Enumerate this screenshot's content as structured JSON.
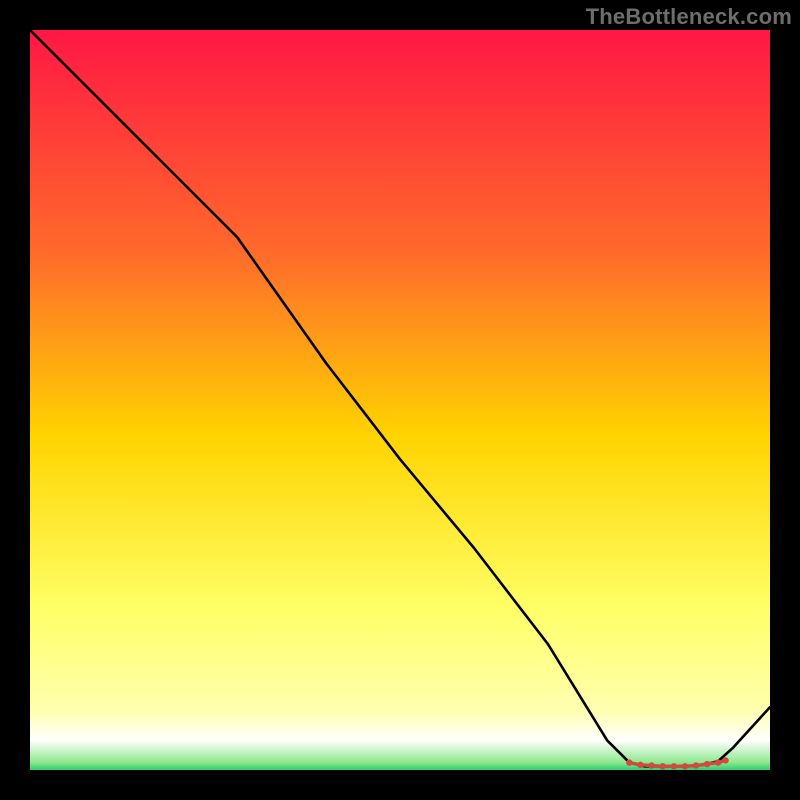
{
  "watermark": "TheBottleneck.com",
  "chart_data": {
    "type": "line",
    "title": "",
    "xlabel": "",
    "ylabel": "",
    "xlim": [
      0,
      100
    ],
    "ylim": [
      0,
      100
    ],
    "grid": false,
    "legend": false,
    "gradient_stops": [
      {
        "offset": 0.0,
        "color": "#ff1744"
      },
      {
        "offset": 0.3,
        "color": "#ff6a2b"
      },
      {
        "offset": 0.55,
        "color": "#ffd400"
      },
      {
        "offset": 0.78,
        "color": "#ffff66"
      },
      {
        "offset": 0.92,
        "color": "#ffffb0"
      },
      {
        "offset": 0.96,
        "color": "#ffffff"
      },
      {
        "offset": 0.99,
        "color": "#8ce88c"
      },
      {
        "offset": 1.0,
        "color": "#2ecc71"
      }
    ],
    "series": [
      {
        "name": "bottleneck-curve",
        "x": [
          0,
          8,
          20,
          28,
          40,
          50,
          60,
          70,
          78,
          81,
          83,
          86,
          89,
          91,
          93,
          95,
          100
        ],
        "y": [
          100,
          92,
          80,
          72,
          55,
          42,
          30,
          17,
          4,
          1,
          0.5,
          0.5,
          0.5,
          0.7,
          1.2,
          3,
          8.5
        ]
      }
    ],
    "highlight_region": {
      "name": "optimal-zone",
      "x_start": 81,
      "x_end": 94,
      "points_x": [
        81,
        82.5,
        84,
        85.5,
        87,
        88.5,
        90,
        91.5,
        93,
        94
      ],
      "points_y": [
        1.0,
        0.7,
        0.6,
        0.5,
        0.5,
        0.5,
        0.6,
        0.8,
        1.0,
        1.3
      ],
      "marker_color": "#d24a3f",
      "marker_radius": 3.2
    }
  }
}
